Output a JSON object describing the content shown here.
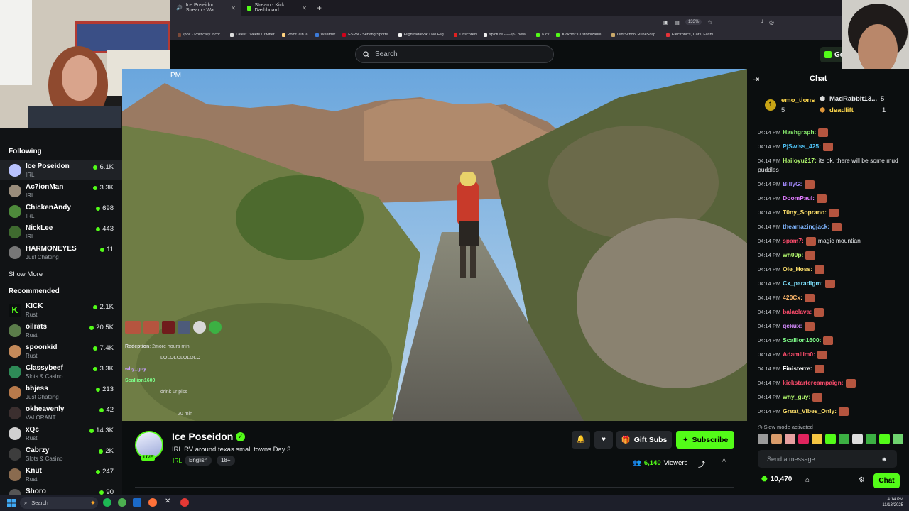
{
  "browser": {
    "tabs": [
      {
        "label": "Ice Poseidon Stream - Wa",
        "active": true
      },
      {
        "label": "Stream - Kick Dashboard",
        "active": false
      }
    ],
    "zoom": "133%",
    "bookmarks": [
      "/pol/ - Politically Incor...",
      "Latest Tweets / Twitter",
      "Pomf.lain.la",
      "Weather",
      "ESPN - Serving Sports...",
      "Flightradar24: Live Flig...",
      "Unscored",
      "spicture ----- ip7.netw...",
      "Kick",
      "KickBot: Customizable...",
      "Old School RuneScap...",
      "Electronics, Cars, Fashi..."
    ]
  },
  "header": {
    "search_placeholder": "Search",
    "get_label": "Get"
  },
  "sidebar": {
    "following_title": "Following",
    "following": [
      {
        "name": "Ice Poseidon",
        "category": "IRL",
        "viewers": "6.1K",
        "color": "#b9c3ff"
      },
      {
        "name": "Ac7ionMan",
        "category": "IRL",
        "viewers": "3.3K",
        "color": "#9a8d7c"
      },
      {
        "name": "ChickenAndy",
        "category": "IRL",
        "viewers": "698",
        "color": "#4e8a3b"
      },
      {
        "name": "NickLee",
        "category": "IRL",
        "viewers": "443",
        "color": "#3f6a2f"
      },
      {
        "name": "HARMONEYES",
        "category": "Just Chatting",
        "viewers": "11",
        "color": "#777777"
      }
    ],
    "show_more": "Show More",
    "recommended_title": "Recommended",
    "recommended": [
      {
        "name": "KICK",
        "category": "Rust",
        "viewers": "2.1K",
        "color": "#53fc18"
      },
      {
        "name": "oilrats",
        "category": "Rust",
        "viewers": "20.5K",
        "color": "#5b7d4a"
      },
      {
        "name": "spoonkid",
        "category": "Rust",
        "viewers": "7.4K",
        "color": "#c48a5a"
      },
      {
        "name": "Classybeef",
        "category": "Slots & Casino",
        "viewers": "3.3K",
        "color": "#2e8b57"
      },
      {
        "name": "bbjess",
        "category": "Just Chatting",
        "viewers": "213",
        "color": "#b87a4b"
      },
      {
        "name": "okheavenly",
        "category": "VALORANT",
        "viewers": "42",
        "color": "#3b2f2f"
      },
      {
        "name": "xQc",
        "category": "Rust",
        "viewers": "14.3K",
        "color": "#d0d0d0"
      },
      {
        "name": "Cabrzy",
        "category": "Slots & Casino",
        "viewers": "2K",
        "color": "#3d3d3d"
      },
      {
        "name": "Knut",
        "category": "Rust",
        "viewers": "247",
        "color": "#8a6b4f"
      },
      {
        "name": "Shoro",
        "category": "",
        "viewers": "90",
        "color": "#555555"
      }
    ]
  },
  "video": {
    "time_fragment": "PM",
    "overlay_chat": [
      {
        "user": "Redeption",
        "text": "2more hours min"
      },
      {
        "user": "",
        "text": "LOLOLOLOLOLO"
      },
      {
        "user": "why_guy",
        "text": ""
      },
      {
        "user": "Scallion1600",
        "text": ""
      },
      {
        "user": "",
        "text": "drink ur piss"
      },
      {
        "user": "",
        "text": ""
      },
      {
        "user": "",
        "text": "20 min"
      }
    ]
  },
  "stream": {
    "name": "Ice Poseidon",
    "live": "LIVE",
    "title": "IRL RV around texas small towns Day 3",
    "category": "IRL",
    "tags": [
      "English",
      "18+"
    ],
    "gift_label": "Gift Subs",
    "subscribe_label": "Subscribe",
    "viewers": "6,140",
    "viewers_label": "Viewers"
  },
  "chat": {
    "title": "Chat",
    "leaderboard": [
      {
        "rank": "1",
        "name": "emo_tions",
        "count": "5"
      },
      {
        "rank": "",
        "name": "MadRabbit13...",
        "count": "5"
      },
      {
        "rank": "",
        "name": "deadlift",
        "count": "1"
      }
    ],
    "messages": [
      {
        "time": "04:14 PM",
        "user": "Hashgraph:",
        "text": "",
        "color": "#84e66b",
        "emote": true
      },
      {
        "time": "04:14 PM",
        "user": "PjSwiss_425:",
        "text": "",
        "color": "#4fc3f7",
        "emote": true
      },
      {
        "time": "04:14 PM",
        "user": "Hailoyu217:",
        "text": "its ok, there will be some mud puddles",
        "color": "#aef36b",
        "emote": false
      },
      {
        "time": "04:14 PM",
        "user": "BillyG:",
        "text": "",
        "color": "#a58bff",
        "emote": true
      },
      {
        "time": "04:14 PM",
        "user": "DoomPaul:",
        "text": "",
        "color": "#e07bff",
        "emote": true
      },
      {
        "time": "04:14 PM",
        "user": "T0ny_Soprano:",
        "text": "",
        "color": "#ffe16b",
        "emote": true
      },
      {
        "time": "04:14 PM",
        "user": "theamazingjack:",
        "text": "",
        "color": "#7fb5ff",
        "emote": true
      },
      {
        "time": "04:14 PM",
        "user": "spam7:",
        "text": "magic mountian",
        "color": "#ff4d6d",
        "emote": true
      },
      {
        "time": "04:14 PM",
        "user": "wh00p:",
        "text": "",
        "color": "#aef36b",
        "emote": true
      },
      {
        "time": "04:14 PM",
        "user": "Ole_Hoss:",
        "text": "",
        "color": "#ffe16b",
        "emote": true
      },
      {
        "time": "04:14 PM",
        "user": "Cx_paradigm:",
        "text": "",
        "color": "#7fe3ff",
        "emote": true
      },
      {
        "time": "04:14 PM",
        "user": "420Cx:",
        "text": "",
        "color": "#ffb86b",
        "emote": true
      },
      {
        "time": "04:14 PM",
        "user": "balaclava:",
        "text": "",
        "color": "#ff4d6d",
        "emote": true
      },
      {
        "time": "04:14 PM",
        "user": "qekux:",
        "text": "",
        "color": "#d68bff",
        "emote": true
      },
      {
        "time": "04:14 PM",
        "user": "Scallion1600:",
        "text": "",
        "color": "#7fff8a",
        "emote": true
      },
      {
        "time": "04:14 PM",
        "user": "Adamllim0:",
        "text": "",
        "color": "#ff4d6d",
        "emote": true
      },
      {
        "time": "04:14 PM",
        "user": "Finisterre:",
        "text": "",
        "color": "#ffffff",
        "emote": true
      },
      {
        "time": "04:14 PM",
        "user": "kickstartercampaign:",
        "text": "",
        "color": "#ff4d6d",
        "emote": true
      },
      {
        "time": "04:14 PM",
        "user": "why_guy:",
        "text": "",
        "color": "#aef36b",
        "emote": true
      },
      {
        "time": "04:14 PM",
        "user": "Great_Vibes_Only:",
        "text": "",
        "color": "#ffe16b",
        "emote": true
      }
    ],
    "slow_mode": "Slow mode activated",
    "send_placeholder": "Send a message",
    "points": "10,470",
    "chat_button": "Chat"
  },
  "taskbar": {
    "search": "Search",
    "time": "4:14 PM",
    "date": "11/13/2025"
  }
}
